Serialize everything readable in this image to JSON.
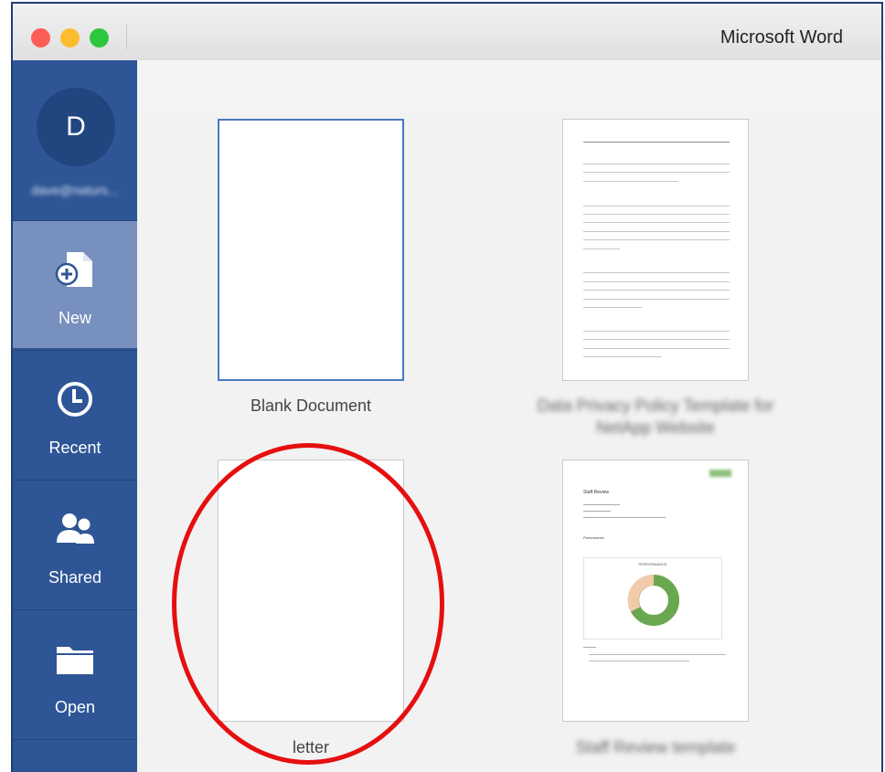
{
  "window": {
    "title": "Microsoft Word"
  },
  "account": {
    "initial": "D",
    "email": "dave@naturs..."
  },
  "sidebar": {
    "items": [
      {
        "label": "New",
        "icon": "new-document-icon",
        "active": true
      },
      {
        "label": "Recent",
        "icon": "clock-icon",
        "active": false
      },
      {
        "label": "Shared",
        "icon": "people-icon",
        "active": false
      },
      {
        "label": "Open",
        "icon": "folder-icon",
        "active": false
      }
    ]
  },
  "templates": [
    {
      "label": "Blank Document",
      "selected": true
    },
    {
      "label": "Data Privacy Policy Template for NetApp Website",
      "selected": false
    },
    {
      "label": "letter",
      "selected": false
    },
    {
      "label": "Staff Review template",
      "selected": false
    }
  ],
  "staff_review_preview": {
    "heading": "Staff Review",
    "section": "Performance",
    "chart_title": "PERFORMANCE"
  },
  "colors": {
    "sidebar": "#2e5596",
    "active": "#7890bd",
    "highlight": "#e60f0f",
    "donut_green": "#6aa84f",
    "donut_peach": "#f2c9a9"
  }
}
